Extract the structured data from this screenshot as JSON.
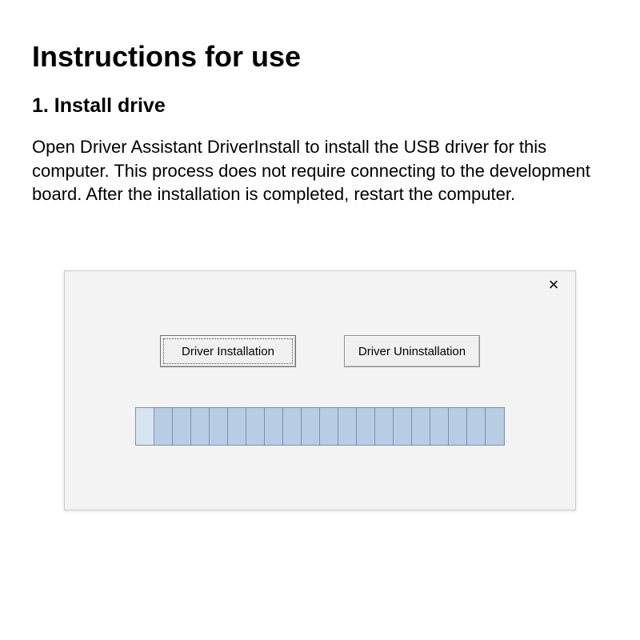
{
  "page": {
    "title": "Instructions for use",
    "step_heading": "1. Install drive",
    "step_body": "Open Driver Assistant DriverInstall to install the USB driver for this computer. This process does not require connecting to the development board. After the installation is completed, restart the computer."
  },
  "window": {
    "close_label": "×",
    "buttons": {
      "install": "Driver Installation",
      "uninstall": "Driver Uninstallation"
    },
    "progress_segments": 20
  }
}
